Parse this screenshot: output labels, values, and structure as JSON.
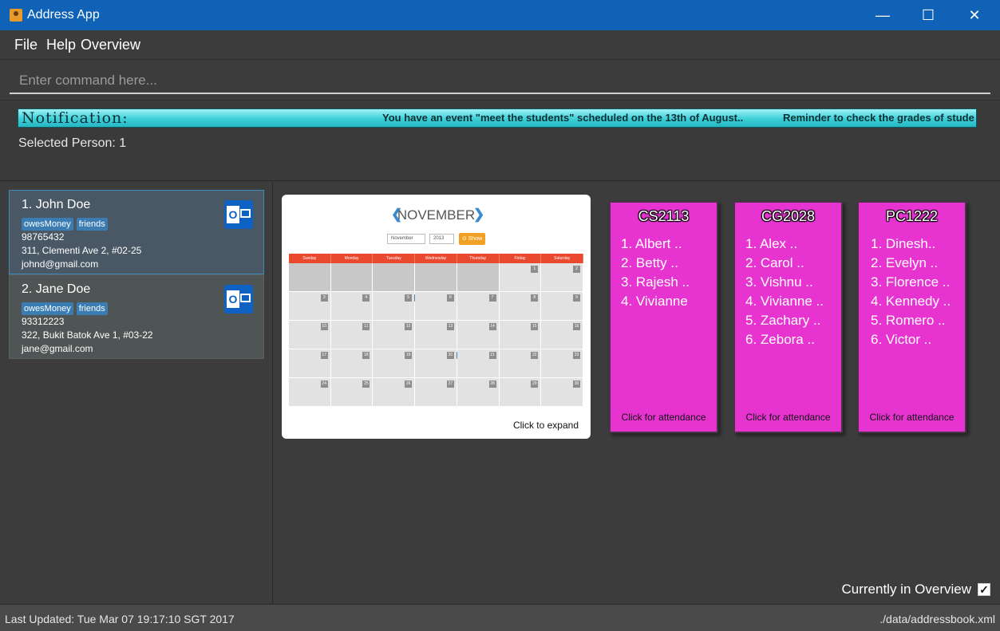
{
  "window": {
    "title": "Address App",
    "minimize_glyph": "—",
    "maximize_glyph": "☐",
    "close_glyph": "✕"
  },
  "menu": {
    "items": [
      "File",
      "Help",
      "Overview"
    ]
  },
  "command": {
    "placeholder": "Enter command here...",
    "value": ""
  },
  "notification": {
    "label": "Notification:",
    "messages": [
      "You have an event \"meet the students\" scheduled on the 13th of August..",
      "Reminder to check the grades of stude"
    ]
  },
  "selected_person": "Selected Person: 1",
  "persons": [
    {
      "name": "1. John Doe",
      "tags": [
        "owesMoney",
        "friends"
      ],
      "phone": "98765432",
      "address": "311, Clementi Ave 2, #02-25",
      "email": "johnd@gmail.com",
      "selected": true,
      "icon": "outlook-icon"
    },
    {
      "name": "2. Jane Doe",
      "tags": [
        "owesMoney",
        "friends"
      ],
      "phone": "93312223",
      "address": "322, Bukit Batok Ave 1, #03-22",
      "email": "jane@gmail.com",
      "selected": false,
      "icon": "outlook-icon"
    }
  ],
  "calendar": {
    "month": "NOVEMBER",
    "select_month": "November",
    "select_year": "2013",
    "show_label": "⊙ Show",
    "weekdays": [
      "Sunday",
      "Monday",
      "Tuesday",
      "Wednesday",
      "Thursday",
      "Friday",
      "Saturday"
    ],
    "weeks": [
      [
        "",
        "",
        "",
        "",
        "",
        "1",
        "2"
      ],
      [
        "3",
        "4",
        "5",
        "6",
        "7",
        "8",
        "9"
      ],
      [
        "10",
        "11",
        "12",
        "13",
        "14",
        "15",
        "16"
      ],
      [
        "17",
        "18",
        "19",
        "20",
        "21",
        "22",
        "23"
      ],
      [
        "24",
        "25",
        "26",
        "27",
        "28",
        "29",
        "30"
      ]
    ],
    "event_days": [
      "5",
      "20"
    ],
    "expand_label": "Click to expand",
    "colors": {
      "header": "#e8492f",
      "event": "#3b8ad0",
      "show_button": "#f1a024"
    }
  },
  "modules": [
    {
      "code": "CS2113",
      "students": [
        "1. Albert ..",
        "2. Betty ..",
        "3. Rajesh ..",
        "4. Vivianne"
      ],
      "attendance_label": "Click for attendance"
    },
    {
      "code": "CG2028",
      "students": [
        "1. Alex ..",
        "2. Carol ..",
        "3. Vishnu ..",
        "4. Vivianne ..",
        "5. Zachary ..",
        "6. Zebora .."
      ],
      "attendance_label": "Click for attendance"
    },
    {
      "code": "PC1222",
      "students": [
        "1. Dinesh..",
        "2. Evelyn ..",
        "3. Florence ..",
        "4. Kennedy ..",
        "5. Romero ..",
        "6. Victor .."
      ],
      "attendance_label": "Click for attendance"
    }
  ],
  "overview": {
    "label": "Currently in Overview",
    "checked": true
  },
  "status": {
    "last_updated": "Last Updated: Tue Mar 07 19:17:10 SGT 2017",
    "file_path": "./data/addressbook.xml"
  },
  "colors": {
    "titlebar": "#0f62b6",
    "module_card": "#e734d1",
    "notification_bar": "#3dcfd8",
    "tag": "#3b7db3"
  }
}
